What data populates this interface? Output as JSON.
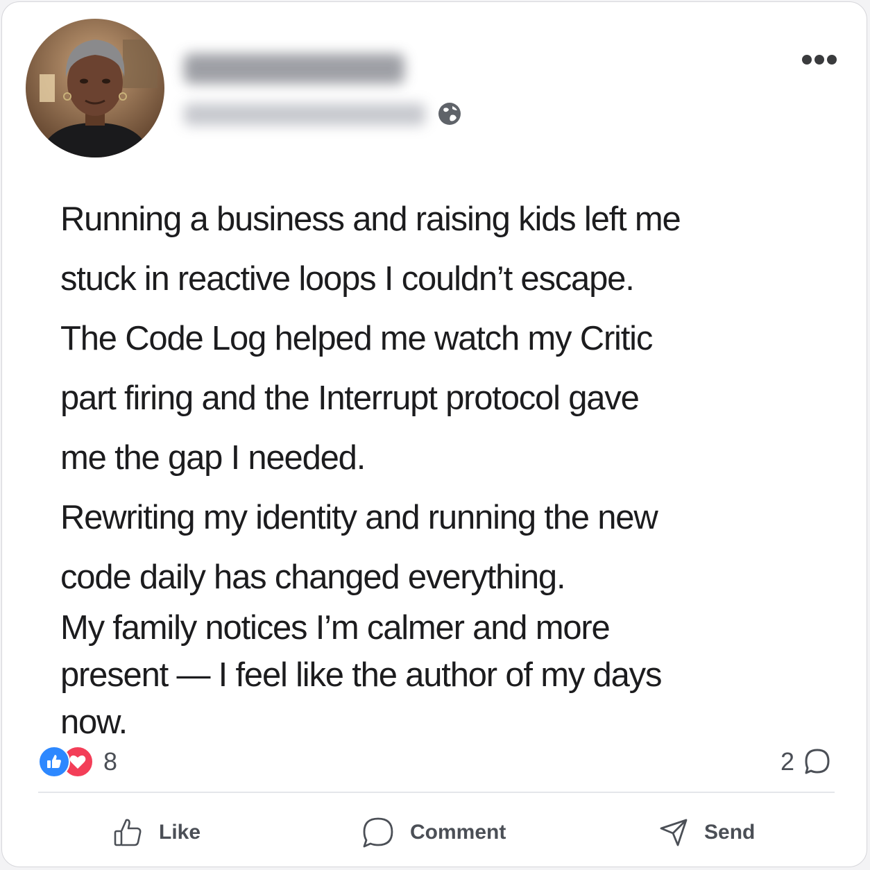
{
  "post": {
    "author_name": "",
    "author_meta": "",
    "visibility_icon": "globe-icon",
    "more_icon": "more-horizontal-icon",
    "body": {
      "lines": [
        "Running a business and raising kids left me",
        "stuck in reactive loops I couldn’t escape.",
        "The Code Log helped me watch my Critic",
        "part firing and the Interrupt protocol gave",
        "me the gap I needed.",
        "Rewriting my identity and running the new",
        "code daily has changed everything.",
        "My family notices I’m calmer and more",
        "present — I feel like the author of my days",
        "now."
      ]
    }
  },
  "stats": {
    "reaction_icons": [
      "like-reaction-icon",
      "love-reaction-icon"
    ],
    "reaction_count": "8",
    "comment_count": "2",
    "comment_icon": "comment-bubble-icon"
  },
  "actions": {
    "like_label": "Like",
    "comment_label": "Comment",
    "send_label": "Send"
  },
  "colors": {
    "like_blue": "#2d88ff",
    "love_red": "#f33e58",
    "text": "#1c1c1e",
    "muted": "#4b4f56"
  }
}
